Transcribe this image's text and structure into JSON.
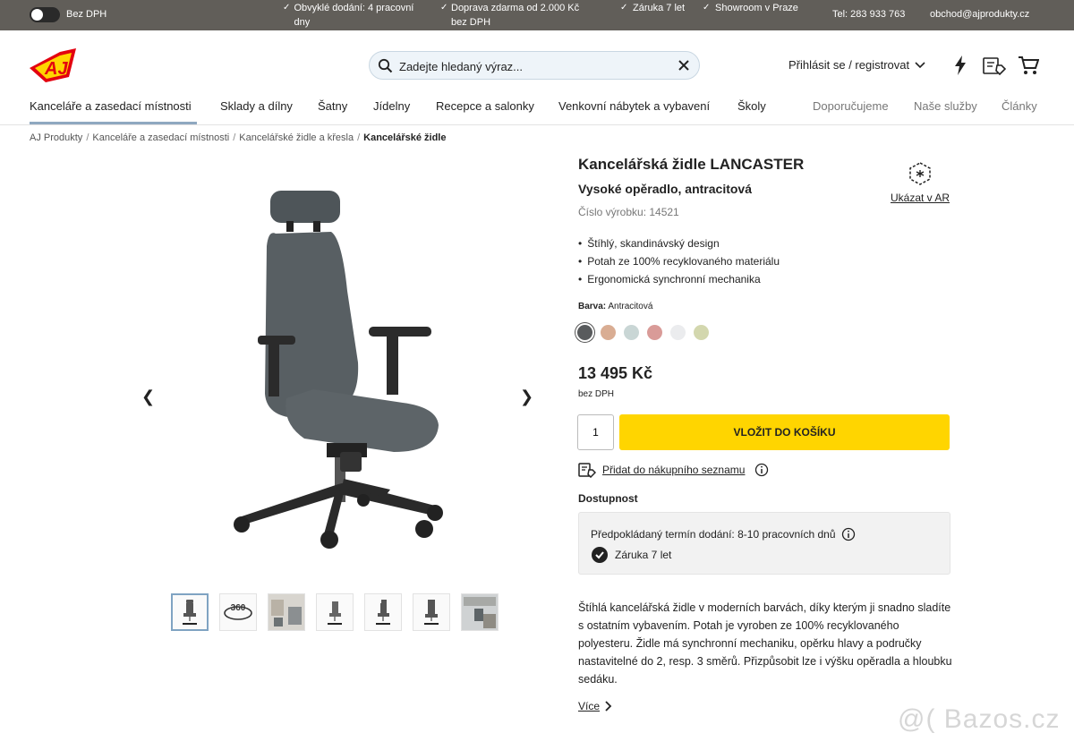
{
  "topbar": {
    "vat_toggle_label": "Bez DPH",
    "usps": [
      "Obvyklé dodání: 4 pracovní dny",
      "Doprava zdarma od 2.000 Kč bez DPH",
      "Záruka 7 let",
      "Showroom v Praze"
    ],
    "phone": "Tel: 283 933 763",
    "email": "obchod@ajprodukty.cz"
  },
  "header": {
    "logo_text": "AJ",
    "search_placeholder": "Zadejte hledaný výraz...",
    "login_label": "Přihlásit se / registrovat"
  },
  "nav": {
    "items": [
      "Kanceláře a zasedací místnosti",
      "Sklady a dílny",
      "Šatny",
      "Jídelny",
      "Recepce a salonky",
      "Venkovní nábytek a vybavení",
      "Školy"
    ],
    "secondary": [
      "Doporučujeme",
      "Naše služby",
      "Články"
    ]
  },
  "breadcrumb": {
    "items": [
      "AJ Produkty",
      "Kanceláře a zasedací místnosti",
      "Kancelářské židle a křesla"
    ],
    "current": "Kancelářské židle"
  },
  "gallery": {
    "thumb_360_label": "360"
  },
  "product": {
    "title": "Kancelářská židle LANCASTER",
    "subtitle": "Vysoké opěradlo, antracitová",
    "number": "Číslo výrobku: 14521",
    "ar_label": "Ukázat v AR",
    "bullets": [
      "Štíhlý, skandinávský design",
      "Potah ze 100% recyklovaného materiálu",
      "Ergonomická synchronní mechanika"
    ],
    "color_label": "Barva:",
    "color_value": "Antracitová",
    "swatches": [
      "#595b5d",
      "#d9ad93",
      "#c9d6d5",
      "#d99b98",
      "#ebecee",
      "#d3d7ae"
    ],
    "price": "13 495 Kč",
    "price_note": "bez DPH",
    "quantity": "1",
    "add_to_cart": "VLOŽIT DO KOŠÍKU",
    "wishlist_label": "Přidat do nákupního seznamu",
    "availability_heading": "Dostupnost",
    "delivery_text": "Předpokládaný termín dodání: 8-10 pracovních dnů",
    "warranty_text": "Záruka 7 let",
    "description": "Štíhlá kancelářská židle v moderních barvách, díky kterým ji snadno sladíte s ostatním vybavením. Potah je vyroben ze 100% recyklovaného polyesteru. Židle má synchronní mechaniku, opěrku hlavy a područky nastavitelné do 2, resp. 3 směrů. Přizpůsobit lze i výšku opěradla a hloubku sedáku.",
    "more_label": "Více"
  },
  "watermark": "@( Bazos.cz"
}
